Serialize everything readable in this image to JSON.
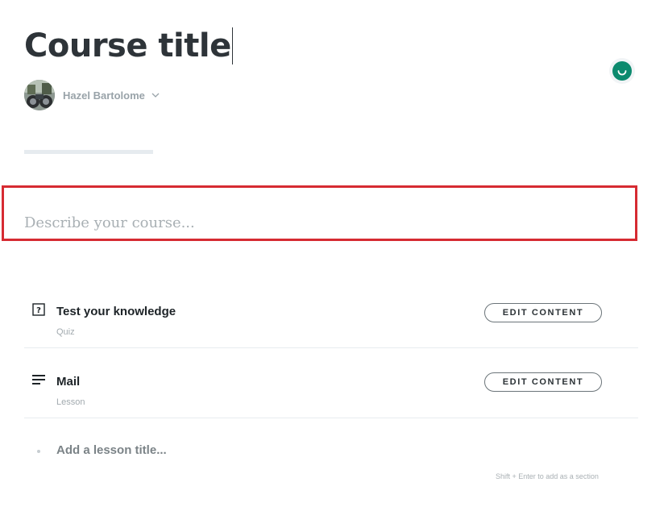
{
  "course": {
    "title": "Course title",
    "author_name": "Hazel Bartolome",
    "progress_fraction": 0,
    "description_placeholder": "Describe your course..."
  },
  "lessons": [
    {
      "title": "Test your knowledge",
      "type": "Quiz",
      "icon": "quiz-icon",
      "action_label": "EDIT CONTENT"
    },
    {
      "title": "Mail",
      "type": "Lesson",
      "icon": "lesson-text-icon",
      "action_label": "EDIT CONTENT"
    }
  ],
  "add_lesson": {
    "placeholder": "Add a lesson title...",
    "hint": "Shift + Enter to add as a section"
  },
  "colors": {
    "accent": "#0c8a6e",
    "highlight_border": "#d62b32",
    "text_dark": "#2e3439",
    "text_muted": "#a2aaaf"
  }
}
